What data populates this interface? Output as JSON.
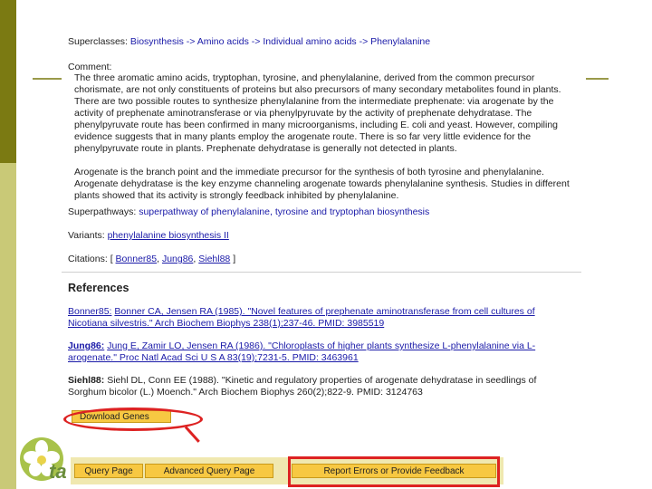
{
  "superclasses": {
    "label": "Superclasses:",
    "path": "Biosynthesis -> Amino acids -> Individual amino acids -> Phenylalanine"
  },
  "comment": {
    "label": "Comment:",
    "paragraph1": "The three aromatic amino acids, tryptophan, tyrosine, and phenylalanine, derived from the common precursor chorismate, are not only constituents of proteins but also precursors of many secondary metabolites found in plants. There are two possible routes to synthesize phenylalanine from the intermediate prephenate: via arogenate by the activity of prephenate aminotransferase or via phenylpyruvate by the activity of prephenate dehydratase. The phenylpyruvate route has been confirmed in many microorganisms, including E. coli and yeast. However, compiling evidence suggests that in many plants employ the arogenate route. There is so far very little evidence for the phenylpyruvate route in plants. Prephenate dehydratase is generally not detected in plants.",
    "paragraph2": "Arogenate is the branch point and the immediate precursor for the synthesis of both tyrosine and phenylalanine. Arogenate dehydratase is the key enzyme channeling arogenate towards phenylalanine synthesis. Studies in different plants showed that its activity is strongly feedback inhibited by phenylalanine."
  },
  "superpathways": {
    "label": "Superpathways:",
    "value": "superpathway of phenylalanine, tyrosine and tryptophan biosynthesis"
  },
  "variants": {
    "label": "Variants:",
    "value": "phenylalanine biosynthesis II"
  },
  "citations": {
    "label": "Citations:",
    "open": "[",
    "items": [
      "Bonner85",
      "Jung86",
      "Siehl88"
    ],
    "close": "]"
  },
  "references": {
    "title": "References",
    "items": [
      {
        "key": "Bonner85:",
        "text": "Bonner CA, Jensen RA (1985). \"Novel features of prephenate aminotransferase from cell cultures of Nicotiana silvestris.\" Arch Biochem Biophys 238(1);237-46. PMID: 3985519"
      },
      {
        "key": "Jung86:",
        "text": "Jung E, Zamir LO, Jensen RA (1986). \"Chloroplasts of higher plants synthesize L-phenylalanine via L-arogenate.\" Proc Natl Acad Sci U S A 83(19);7231-5. PMID: 3463961"
      },
      {
        "key": "Siehl88:",
        "text": "Siehl DL, Conn EE (1988). \"Kinetic and regulatory properties of arogenate dehydratase in seedlings of Sorghum bicolor (L.) Moench.\" Arch Biochem Biophys 260(2);822-9. PMID: 3124763"
      }
    ]
  },
  "download_button": "Download Genes",
  "footer": {
    "query_page": "Query Page",
    "advanced_query": "Advanced Query Page",
    "report_errors": "Report Errors or Provide Feedback"
  },
  "logo_text": "ta",
  "colors": {
    "accent_olive": "#7b7a12",
    "button_yellow": "#f7c842",
    "highlight_red": "#dd2222",
    "link_blue": "#1a1aa8"
  }
}
